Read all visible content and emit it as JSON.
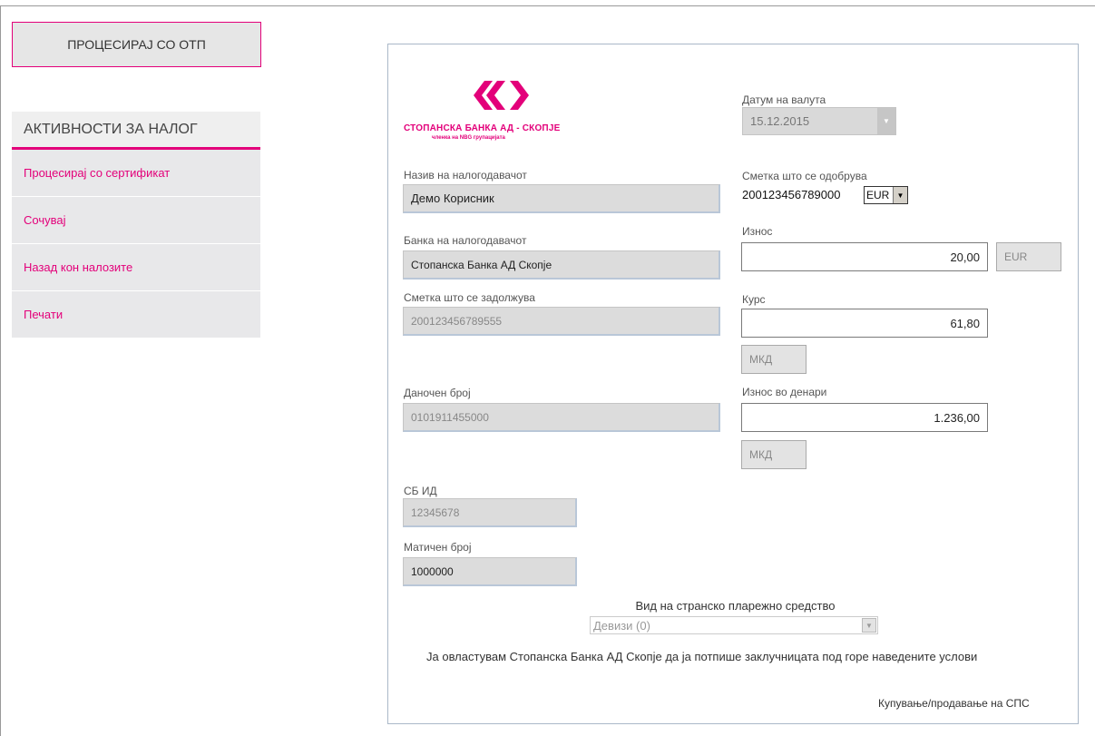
{
  "actions": {
    "process_otp": "ПРОЦЕСИРАЈ СО ОТП"
  },
  "sidebar": {
    "title": "АКТИВНОСТИ ЗА НАЛОГ",
    "items": [
      {
        "label": "Процесирај со сертификат"
      },
      {
        "label": "Сочувај"
      },
      {
        "label": "Назад кон налозите"
      },
      {
        "label": "Печати"
      }
    ]
  },
  "bank": {
    "logo_name": "СТОПАНСКА БАНКА АД - СКОПЈЕ",
    "logo_sub": "членка на NBG групацијата",
    "brand_color": "#e3007a"
  },
  "form": {
    "payer_name_label": "Назив на налогодавачот",
    "payer_name": "Демо Корисник",
    "payer_bank_label": "Банка на налогодавачот",
    "payer_bank": "Стопанска Банка АД Скопје",
    "debit_account_label": "Сметка што се задолжува",
    "debit_account": "200123456789555",
    "tax_number_label": "Даночен број",
    "tax_number": "0101911455000",
    "sb_id_label": "СБ ИД",
    "sb_id": "12345678",
    "reg_number_label": "Матичен број",
    "reg_number": "1000000",
    "value_date_label": "Датум на валута",
    "value_date": "15.12.2015",
    "credit_account_label": "Сметка што се одобрува",
    "credit_account": "200123456789000",
    "credit_currency": "EUR",
    "amount_label": "Износ",
    "amount": "20,00",
    "amount_currency": "EUR",
    "rate_label": "Курс",
    "rate": "61,80",
    "rate_currency": "МКД",
    "amount_mkd_label": "Износ во денари",
    "amount_mkd": "1.236,00",
    "amount_mkd_currency": "МКД",
    "instrument_label": "Вид на странско пларежно средство",
    "instrument": "Девизи (0)",
    "consent_text": "Ја овластувам Стопанска Банка АД Скопје да ја потпише заклучницата под горе наведените услови",
    "footer": "Купување/продавање на СПС"
  }
}
